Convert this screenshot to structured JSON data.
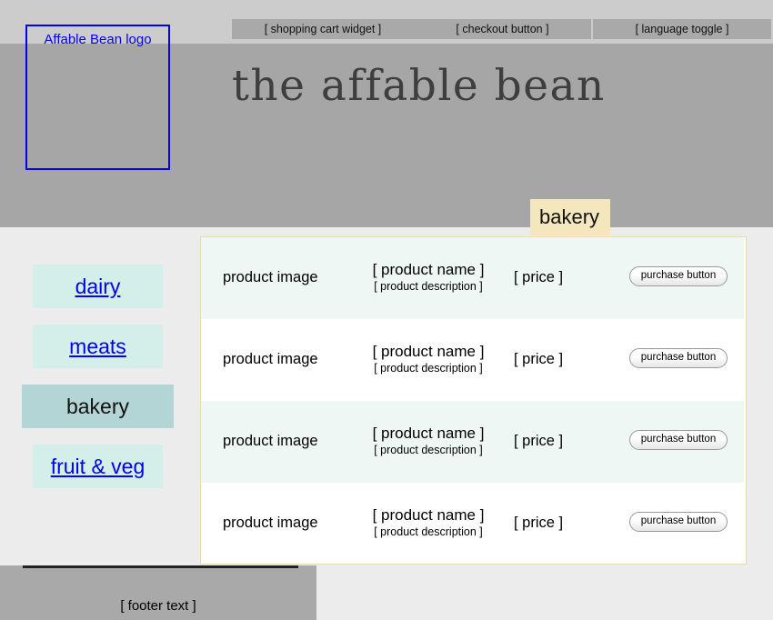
{
  "header": {
    "logo_label": "Affable Bean logo",
    "site_title": "the affable bean",
    "widgets": [
      {
        "label": "[ shopping cart widget ]",
        "name": "shopping-cart-widget"
      },
      {
        "label": "[ checkout button ]",
        "name": "checkout-button"
      },
      {
        "label": "[ language toggle ]",
        "name": "language-toggle"
      }
    ]
  },
  "category_tab": {
    "label": "bakery"
  },
  "sidebar": {
    "items": [
      {
        "label": "dairy",
        "active": false
      },
      {
        "label": "meats",
        "active": false
      },
      {
        "label": "bakery",
        "active": true
      },
      {
        "label": "fruit & veg",
        "active": false
      }
    ]
  },
  "products": {
    "rows": [
      {
        "image": "product image",
        "name": "[ product name ]",
        "description": "[ product description ]",
        "price": "[ price ]",
        "action": "purchase button"
      },
      {
        "image": "product image",
        "name": "[ product name ]",
        "description": "[ product description ]",
        "price": "[ price ]",
        "action": "purchase button"
      },
      {
        "image": "product image",
        "name": "[ product name ]",
        "description": "[ product description ]",
        "price": "[ price ]",
        "action": "purchase button"
      },
      {
        "image": "product image",
        "name": "[ product name ]",
        "description": "[ product description ]",
        "price": "[ price ]",
        "action": "purchase button"
      }
    ]
  },
  "footer": {
    "text": "[ footer text ]"
  },
  "colors": {
    "top_strip": "#cccccc",
    "header_band": "#a6a6a6",
    "widget_bg": "#a9a9a9",
    "logo_border": "#0000ee",
    "title_text": "#3e3e3e",
    "tab_bg": "#f5e7bd",
    "nav_bg": "#d4eeea",
    "nav_active_bg": "#b4d5d5",
    "link_text": "#0000ee",
    "panel_border": "#e8dcb5",
    "row_alt_bg": "#eef7f4",
    "page_bg": "#ececec",
    "footer_bg": "#a9a9a9"
  }
}
